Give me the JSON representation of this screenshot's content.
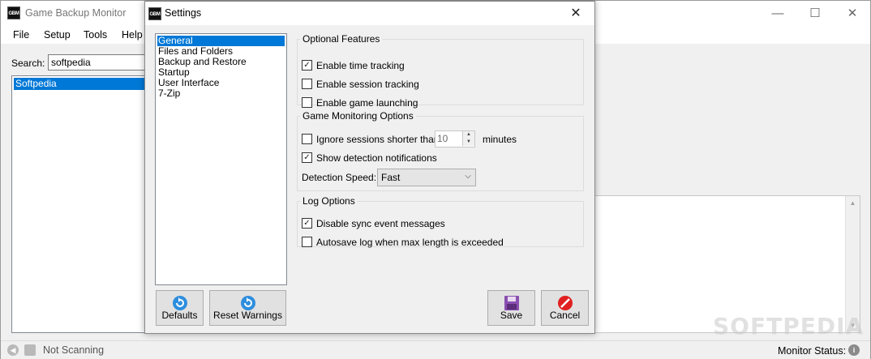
{
  "main_window": {
    "title": "Game Backup Monitor",
    "app_icon_text": "GBM",
    "controls": {
      "minimize": "—",
      "maximize": "☐",
      "close": "✕"
    },
    "menu": [
      "File",
      "Setup",
      "Tools",
      "Help"
    ],
    "search": {
      "label": "Search:",
      "value": "softpedia"
    },
    "games": [
      "Softpedia"
    ],
    "status": {
      "scan": "Not Scanning",
      "monitor_label": "Monitor Status:",
      "monitor_icon": "info-icon"
    },
    "watermark": "SOFTPEDIA"
  },
  "settings": {
    "title": "Settings",
    "icon_text": "GBM",
    "close": "✕",
    "categories": [
      "General",
      "Files and Folders",
      "Backup and Restore",
      "Startup",
      "User Interface",
      "7-Zip"
    ],
    "selected_category": "General",
    "optional_features": {
      "title": "Optional Features",
      "time_tracking": {
        "label": "Enable time tracking",
        "checked": true
      },
      "session_tracking": {
        "label": "Enable session tracking",
        "checked": false
      },
      "game_launching": {
        "label": "Enable game launching",
        "checked": false
      }
    },
    "monitoring": {
      "title": "Game Monitoring Options",
      "ignore_sessions": {
        "label": "Ignore sessions shorter than",
        "checked": false,
        "value": "10",
        "unit": "minutes"
      },
      "detection_notifications": {
        "label": "Show detection notifications",
        "checked": true
      },
      "speed": {
        "label": "Detection Speed:",
        "value": "Fast"
      }
    },
    "log": {
      "title": "Log Options",
      "disable_sync": {
        "label": "Disable sync event messages",
        "checked": true
      },
      "autosave": {
        "label": "Autosave log when max length is exceeded",
        "checked": false
      }
    },
    "buttons": {
      "defaults": "Defaults",
      "reset_warnings": "Reset Warnings",
      "save": "Save",
      "cancel": "Cancel"
    },
    "colors": {
      "selection": "#0078d7",
      "save_icon": "#8a4fb0",
      "cancel_icon": "#e02020",
      "reset_icon": "#2e8ede"
    }
  }
}
